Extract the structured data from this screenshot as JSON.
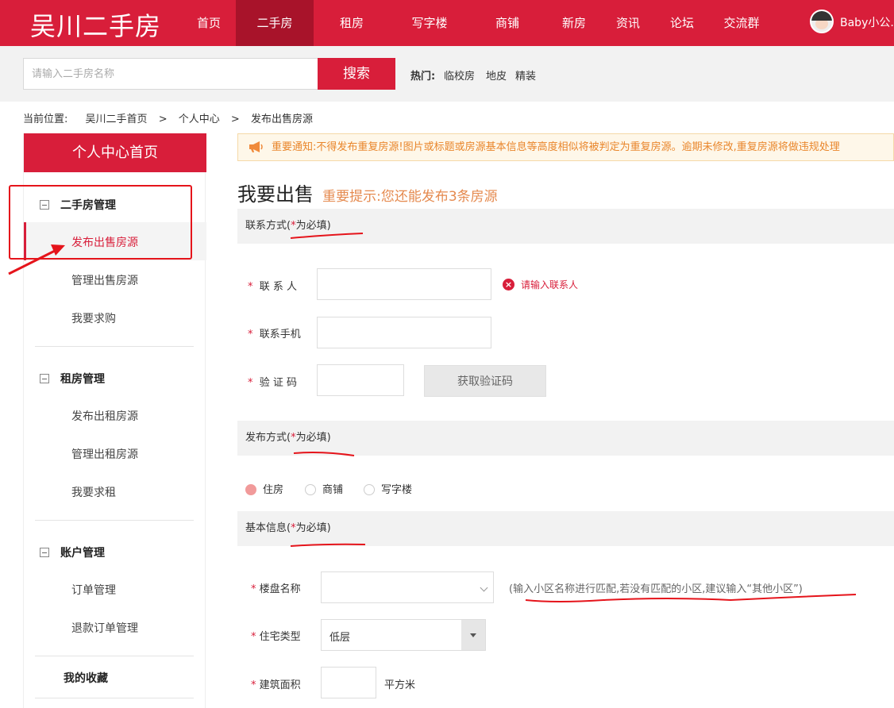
{
  "header": {
    "logo": "吴川二手房",
    "nav": [
      {
        "label": "首页",
        "active": false
      },
      {
        "label": "二手房",
        "active": true
      },
      {
        "label": "租房",
        "active": false
      },
      {
        "label": "写字楼",
        "active": false
      },
      {
        "label": "商铺",
        "active": false
      },
      {
        "label": "新房",
        "active": false
      },
      {
        "label": "资讯",
        "active": false
      },
      {
        "label": "论坛",
        "active": false
      },
      {
        "label": "交流群",
        "active": false
      }
    ],
    "username": "Baby小公..."
  },
  "search": {
    "placeholder": "请输入二手房名称",
    "button": "搜索",
    "hot_label": "热门:",
    "hot_tags": [
      "临校房",
      "地皮",
      "精装"
    ]
  },
  "breadcrumb": {
    "label": "当前位置:",
    "items": [
      "吴川二手首页",
      "个人中心",
      "发布出售房源"
    ],
    "sep": ">"
  },
  "sidebar": {
    "home": "个人中心首页",
    "groups": [
      {
        "title": "二手房管理",
        "items": [
          "发布出售房源",
          "管理出售房源",
          "我要求购"
        ]
      },
      {
        "title": "租房管理",
        "items": [
          "发布出租房源",
          "管理出租房源",
          "我要求租"
        ]
      },
      {
        "title": "账户管理",
        "items": [
          "订单管理",
          "退款订单管理"
        ]
      }
    ],
    "favorites": "我的收藏"
  },
  "main": {
    "notice": "重要通知:不得发布重复房源!图片或标题或房源基本信息等高度相似将被判定为重复房源。逾期未修改,重复房源将做违规处理",
    "title": "我要出售",
    "tip": "重要提示:您还能发布3条房源",
    "sections": {
      "contact": {
        "title": "联系方式",
        "req_open": "(",
        "req_star": "*",
        "req_text": "为必填",
        "req_close": ")"
      },
      "publish": {
        "title": "发布方式",
        "req_open": "(",
        "req_star": "*",
        "req_text": "为必填",
        "req_close": ")"
      },
      "basic": {
        "title": "基本信息",
        "req_open": "(",
        "req_star": "*",
        "req_text": "为必填",
        "req_close": ")"
      }
    },
    "fields": {
      "contact_name": {
        "star": "*",
        "label": "联 系 人",
        "value": "",
        "error": "请输入联系人"
      },
      "phone": {
        "star": "*",
        "label": "联系手机",
        "value": ""
      },
      "code": {
        "star": "*",
        "label": "验 证 码",
        "value": "",
        "button": "获取验证码"
      },
      "estate": {
        "star": "*",
        "label": "楼盘名称",
        "value": "",
        "hint": "(输入小区名称进行匹配,若没有匹配的小区,建议输入“其他小区”)"
      },
      "type": {
        "star": "*",
        "label": "住宅类型",
        "value": "低层"
      },
      "area": {
        "star": "*",
        "label": "建筑面积",
        "value": "",
        "unit": "平方米"
      }
    },
    "publish_options": [
      {
        "label": "住房",
        "checked": true
      },
      {
        "label": "商铺",
        "checked": false
      },
      {
        "label": "写字楼",
        "checked": false
      }
    ]
  },
  "colors": {
    "brand": "#d81e3a",
    "annotation": "#e5141b",
    "notice_text": "#e9862b",
    "tip": "#e58a4f"
  }
}
